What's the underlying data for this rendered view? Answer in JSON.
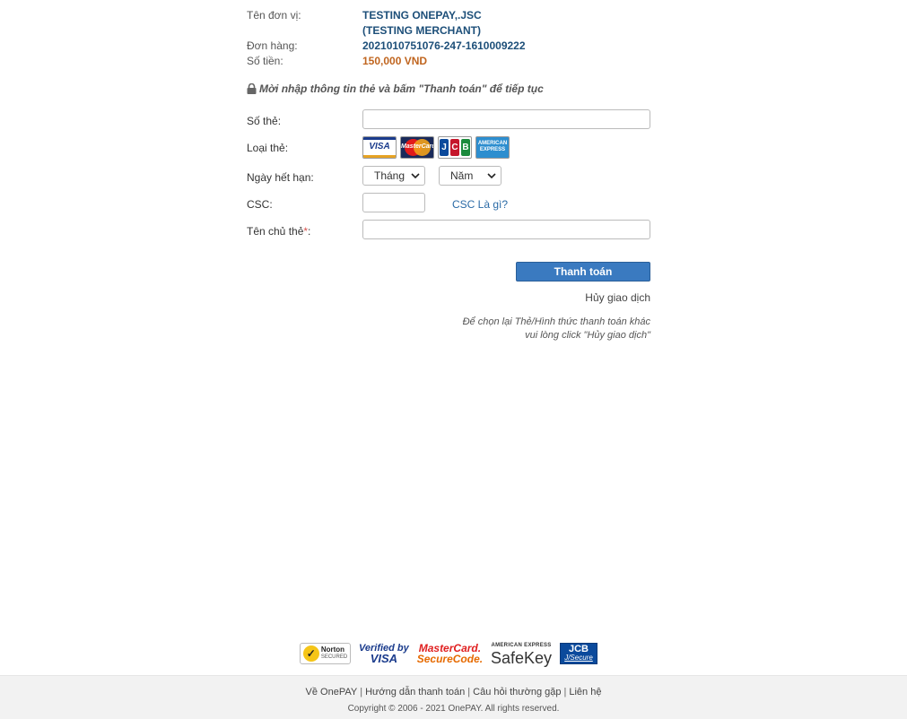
{
  "order_info": {
    "merchant_label": "Tên đơn vị:",
    "merchant_name_line1": "TESTING ONEPAY,.JSC",
    "merchant_name_line2": "(TESTING MERCHANT)",
    "order_label": "Đơn hàng:",
    "order_id": "2021010751076-247-1610009222",
    "amount_label": "Số tiền:",
    "amount": "150,000 VND"
  },
  "notice": {
    "icon": "lock-icon",
    "text": "Mời nhập thông tin thẻ và bấm \"Thanh toán\" để tiếp tục"
  },
  "form": {
    "card_number_label": "Số thẻ:",
    "card_number_value": "",
    "card_type_label": "Loại thẻ:",
    "card_types": [
      "VISA",
      "MasterCard",
      "JCB",
      "AMERICAN EXPRESS"
    ],
    "expiry_label": "Ngày hết hạn:",
    "month_select": "Tháng",
    "year_select": "Năm",
    "csc_label": "CSC:",
    "csc_value": "",
    "csc_help_link": "CSC Là gì?",
    "holder_label": "Tên chủ thẻ",
    "holder_required_mark": "*",
    "holder_colon": ":",
    "holder_value": ""
  },
  "actions": {
    "pay_button": "Thanh toán",
    "cancel_link": "Hủy giao dịch",
    "hint_line1": "Để chọn lại Thẻ/Hình thức thanh toán khác",
    "hint_line2": "vui lòng click \"Hủy giao dịch\""
  },
  "security_logos": {
    "norton_a": "Norton",
    "norton_b": "SECURED",
    "vbv_a": "Verified by",
    "vbv_b": "VISA",
    "mcsc_a": "MasterCard.",
    "mcsc_b": "SecureCode.",
    "safekey_a": "AMERICAN EXPRESS",
    "safekey_b": "SafeKey",
    "jcb_a": "JCB",
    "jcb_b": "J/Secure"
  },
  "footer": {
    "links": [
      "Về OnePAY",
      "Hướng dẫn thanh toán",
      "Câu hỏi thường gặp",
      "Liên hệ"
    ],
    "separator": "|",
    "copyright": "Copyright © 2006 - 2021 OnePAY. All rights reserved."
  },
  "colors": {
    "merchant_text": "#1d4f79",
    "amount_text": "#c0651f",
    "button_bg": "#3a7ac0",
    "link": "#2a6aa6",
    "footer_bg": "#f2f2f2"
  }
}
